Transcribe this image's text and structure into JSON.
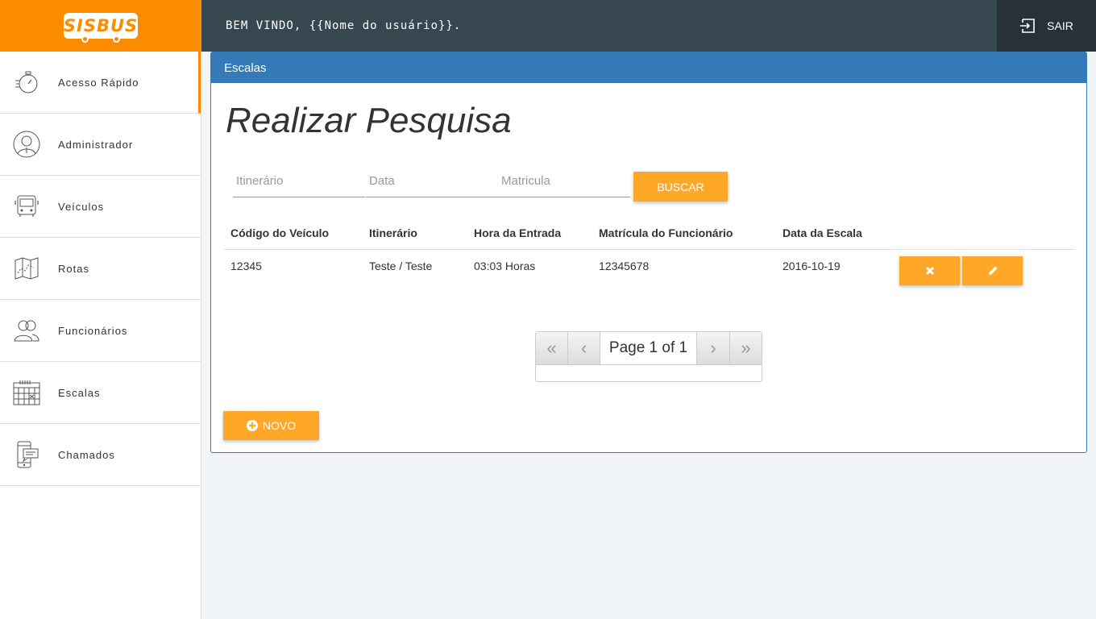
{
  "header": {
    "logo_text": "SISBUS",
    "welcome": "BEM VINDO, {{Nome do usuário}}.",
    "logout_label": "SAIR"
  },
  "sidebar": {
    "items": [
      {
        "label": "Acesso Rápido",
        "icon": "stopwatch-icon"
      },
      {
        "label": "Administrador",
        "icon": "admin-avatar-icon"
      },
      {
        "label": "Veículos",
        "icon": "bus-icon"
      },
      {
        "label": "Rotas",
        "icon": "map-icon"
      },
      {
        "label": "Funcionários",
        "icon": "people-icon"
      },
      {
        "label": "Escalas",
        "icon": "calendar-icon"
      },
      {
        "label": "Chamados",
        "icon": "phone-chat-icon"
      }
    ]
  },
  "panel": {
    "title": "Escalas",
    "heading": "Realizar Pesquisa",
    "filters": {
      "itinerario_placeholder": "Itinerário",
      "data_placeholder": "Data",
      "matricula_placeholder": "Matricula",
      "search_label": "BUSCAR"
    },
    "table": {
      "headers": [
        "Código do Veículo",
        "Itinerário",
        "Hora da Entrada",
        "Matrícula do Funcionário",
        "Data da Escala"
      ],
      "rows": [
        [
          "12345",
          "Teste / Teste",
          "03:03 Horas",
          "12345678",
          "2016-10-19"
        ]
      ]
    },
    "pager": {
      "text": "Page 1 of 1",
      "first": "«",
      "prev": "‹",
      "next": "›",
      "last": "»"
    },
    "new_label": "NOVO"
  },
  "colors": {
    "brand_orange": "#fb8c00",
    "button_orange": "#ffa726",
    "topbar": "#37474f",
    "panel_blue": "#337ab7"
  }
}
